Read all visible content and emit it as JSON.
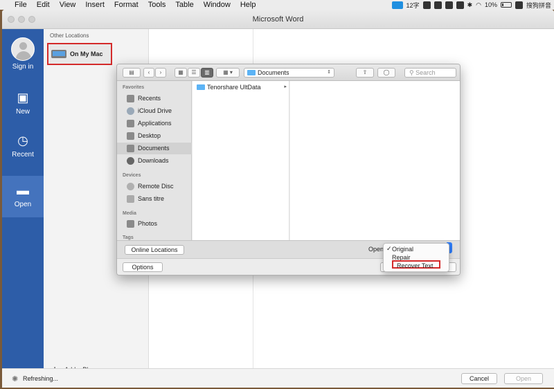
{
  "menubar": {
    "apple": "",
    "items": [
      "File",
      "Edit",
      "View",
      "Insert",
      "Format",
      "Tools",
      "Table",
      "Window",
      "Help"
    ],
    "status": {
      "input_method": "12字",
      "battery": "10%",
      "app_label": "搜狗拼音"
    }
  },
  "window": {
    "title": "Microsoft Word"
  },
  "nav": {
    "sign_in": "Sign in",
    "new": "New",
    "recent": "Recent",
    "open": "Open"
  },
  "places": {
    "header": "Other Locations",
    "on_my_mac": "On My Mac",
    "add_place": "Add a Place"
  },
  "status_bar": {
    "refreshing": "Refreshing...",
    "cancel": "Cancel",
    "open": "Open"
  },
  "dialog": {
    "path": "Documents",
    "search_placeholder": "Search",
    "sections": {
      "favorites": "Favorites",
      "devices": "Devices",
      "media": "Media",
      "tags": "Tags"
    },
    "favorites": [
      "Recents",
      "iCloud Drive",
      "Applications",
      "Desktop",
      "Documents",
      "Downloads"
    ],
    "devices": [
      "Remote Disc",
      "Sans titre"
    ],
    "media": [
      "Photos"
    ],
    "files": [
      {
        "name": "Tenorshare UltData",
        "arrow": "▸"
      }
    ],
    "online_locations": "Online Locations",
    "options": "Options",
    "open_label": "Open",
    "open_menu": {
      "options": [
        "Original",
        "Repair",
        "Recover Text"
      ],
      "selected": "Original",
      "check": "✓"
    }
  },
  "colors": {
    "accent_blue": "#2d5da8",
    "highlight_red": "#d42a2a"
  }
}
